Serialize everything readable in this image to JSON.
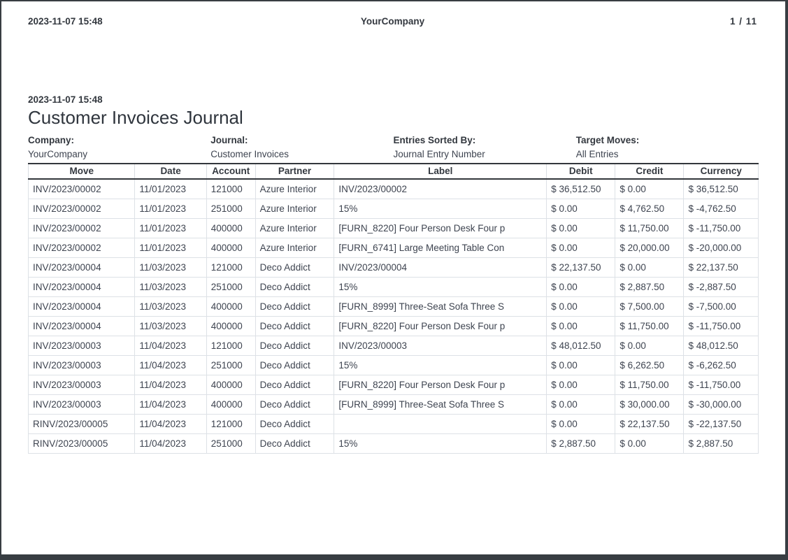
{
  "page_header": {
    "datetime": "2023-11-07 15:48",
    "company": "YourCompany",
    "pagination": "1 / 11"
  },
  "document": {
    "datetime": "2023-11-07 15:48",
    "title": "Customer Invoices Journal",
    "meta": [
      {
        "label": "Company:",
        "value": "YourCompany"
      },
      {
        "label": "Journal:",
        "value": "Customer Invoices"
      },
      {
        "label": "Entries Sorted By:",
        "value": "Journal Entry Number"
      },
      {
        "label": "Target Moves:",
        "value": "All Entries"
      }
    ]
  },
  "table": {
    "columns": [
      "Move",
      "Date",
      "Account",
      "Partner",
      "Label",
      "Debit",
      "Credit",
      "Currency"
    ],
    "column_keys": [
      "move",
      "date",
      "account",
      "partner",
      "label",
      "debit",
      "credit",
      "currency"
    ],
    "rows": [
      {
        "move": "INV/2023/00002",
        "date": "11/01/2023",
        "account": "121000",
        "partner": "Azure Interior",
        "label": "INV/2023/00002",
        "debit": "$ 36,512.50",
        "credit": "$ 0.00",
        "currency": "$ 36,512.50"
      },
      {
        "move": "INV/2023/00002",
        "date": "11/01/2023",
        "account": "251000",
        "partner": "Azure Interior",
        "label": "15%",
        "debit": "$ 0.00",
        "credit": "$ 4,762.50",
        "currency": "$ -4,762.50"
      },
      {
        "move": "INV/2023/00002",
        "date": "11/01/2023",
        "account": "400000",
        "partner": "Azure Interior",
        "label": "[FURN_8220] Four Person Desk Four p",
        "debit": "$ 0.00",
        "credit": "$ 11,750.00",
        "currency": "$ -11,750.00"
      },
      {
        "move": "INV/2023/00002",
        "date": "11/01/2023",
        "account": "400000",
        "partner": "Azure Interior",
        "label": "[FURN_6741] Large Meeting Table Con",
        "debit": "$ 0.00",
        "credit": "$ 20,000.00",
        "currency": "$ -20,000.00"
      },
      {
        "move": "INV/2023/00004",
        "date": "11/03/2023",
        "account": "121000",
        "partner": "Deco Addict",
        "label": "INV/2023/00004",
        "debit": "$ 22,137.50",
        "credit": "$ 0.00",
        "currency": "$ 22,137.50"
      },
      {
        "move": "INV/2023/00004",
        "date": "11/03/2023",
        "account": "251000",
        "partner": "Deco Addict",
        "label": "15%",
        "debit": "$ 0.00",
        "credit": "$ 2,887.50",
        "currency": "$ -2,887.50"
      },
      {
        "move": "INV/2023/00004",
        "date": "11/03/2023",
        "account": "400000",
        "partner": "Deco Addict",
        "label": "[FURN_8999] Three-Seat Sofa Three S",
        "debit": "$ 0.00",
        "credit": "$ 7,500.00",
        "currency": "$ -7,500.00"
      },
      {
        "move": "INV/2023/00004",
        "date": "11/03/2023",
        "account": "400000",
        "partner": "Deco Addict",
        "label": "[FURN_8220] Four Person Desk Four p",
        "debit": "$ 0.00",
        "credit": "$ 11,750.00",
        "currency": "$ -11,750.00"
      },
      {
        "move": "INV/2023/00003",
        "date": "11/04/2023",
        "account": "121000",
        "partner": "Deco Addict",
        "label": "INV/2023/00003",
        "debit": "$ 48,012.50",
        "credit": "$ 0.00",
        "currency": "$ 48,012.50"
      },
      {
        "move": "INV/2023/00003",
        "date": "11/04/2023",
        "account": "251000",
        "partner": "Deco Addict",
        "label": "15%",
        "debit": "$ 0.00",
        "credit": "$ 6,262.50",
        "currency": "$ -6,262.50"
      },
      {
        "move": "INV/2023/00003",
        "date": "11/04/2023",
        "account": "400000",
        "partner": "Deco Addict",
        "label": "[FURN_8220] Four Person Desk Four p",
        "debit": "$ 0.00",
        "credit": "$ 11,750.00",
        "currency": "$ -11,750.00"
      },
      {
        "move": "INV/2023/00003",
        "date": "11/04/2023",
        "account": "400000",
        "partner": "Deco Addict",
        "label": "[FURN_8999] Three-Seat Sofa Three S",
        "debit": "$ 0.00",
        "credit": "$ 30,000.00",
        "currency": "$ -30,000.00"
      },
      {
        "move": "RINV/2023/00005",
        "date": "11/04/2023",
        "account": "121000",
        "partner": "Deco Addict",
        "label": "",
        "debit": "$ 0.00",
        "credit": "$ 22,137.50",
        "currency": "$ -22,137.50"
      },
      {
        "move": "RINV/2023/00005",
        "date": "11/04/2023",
        "account": "251000",
        "partner": "Deco Addict",
        "label": "15%",
        "debit": "$ 2,887.50",
        "credit": "$ 0.00",
        "currency": "$ 2,887.50"
      }
    ]
  },
  "colors": {
    "page_background": "#ffffff",
    "frame": "#383d42",
    "text": "#3e4450",
    "header_rule": "#33373c",
    "grid_line": "#dde1e6"
  }
}
